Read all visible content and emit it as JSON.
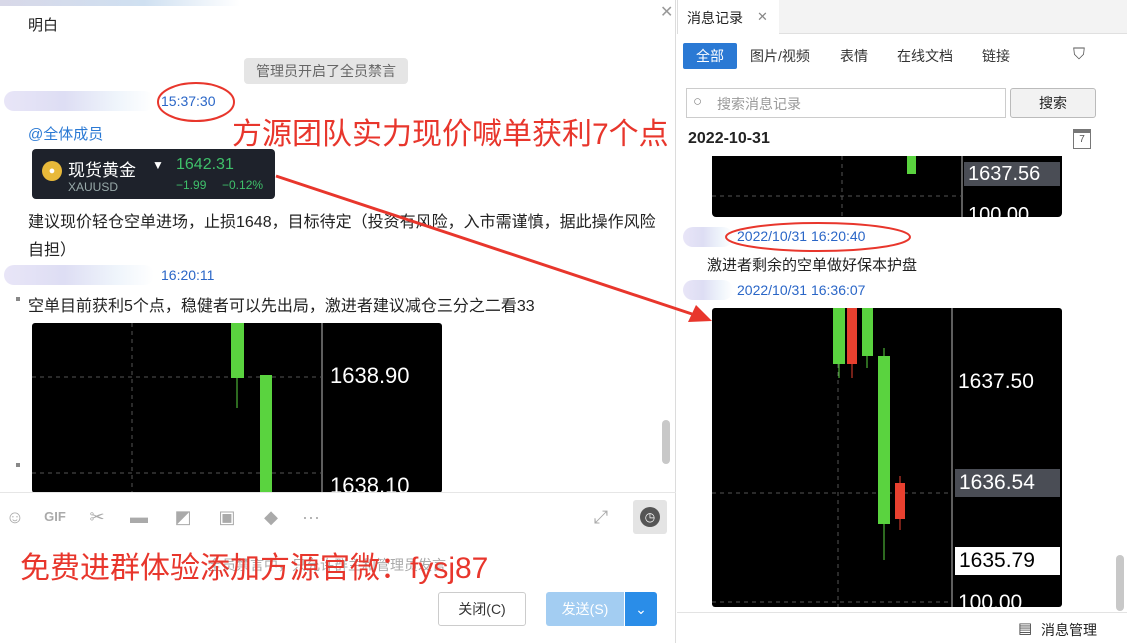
{
  "left_chat": {
    "top_message": "明白",
    "system_notice": "管理员开启了全员禁言",
    "msg1": {
      "time": "15:37:30",
      "mention": "@全体成员",
      "card": {
        "name": "现货黄金",
        "symbol": "XAUUSD",
        "price": "1642.31",
        "change": "−1.99",
        "change_pct": "−0.12%"
      },
      "text": "建议现价轻仓空单进场，止损1648，目标待定（投资有风险，入市需谨慎，据此操作风险自担）"
    },
    "msg2": {
      "time": "16:20:11",
      "text": "空单目前获利5个点，稳健者可以先出局，激进者建议减仓三分之二看33",
      "chart_label_top": "1638.90",
      "chart_label_bottom": "1638.10"
    },
    "input_placeholder": "全员禁言中，只允许群主和管理员发言",
    "close_button": "关闭(C)",
    "send_button": "发送(S)"
  },
  "history": {
    "tab_title": "消息记录",
    "filters": [
      "全部",
      "图片/视频",
      "表情",
      "在线文档",
      "链接"
    ],
    "search_placeholder": "搜索消息记录",
    "search_button": "搜索",
    "date_header": "2022-10-31",
    "calendar_day": "7",
    "chart1_label": "1637.56",
    "chart1_bottom": "100.00",
    "entry1_time": "2022/10/31 16:20:40",
    "entry1_text": "激进者剩余的空单做好保本护盘",
    "entry2_time": "2022/10/31 16:36:07",
    "chart2_labels": [
      "1637.50",
      "1636.54",
      "1635.79",
      "100.00"
    ],
    "manage_label": "消息管理"
  },
  "overlay": {
    "headline": "方源团队实力现价喊单获利7个点",
    "promo": "免费进群体验添加方源官微：fysj87"
  },
  "colors": {
    "accent": "#2a79d4",
    "overlay_red": "#e8362c",
    "candle_green": "#5ad33f",
    "candle_red": "#e8402f"
  }
}
